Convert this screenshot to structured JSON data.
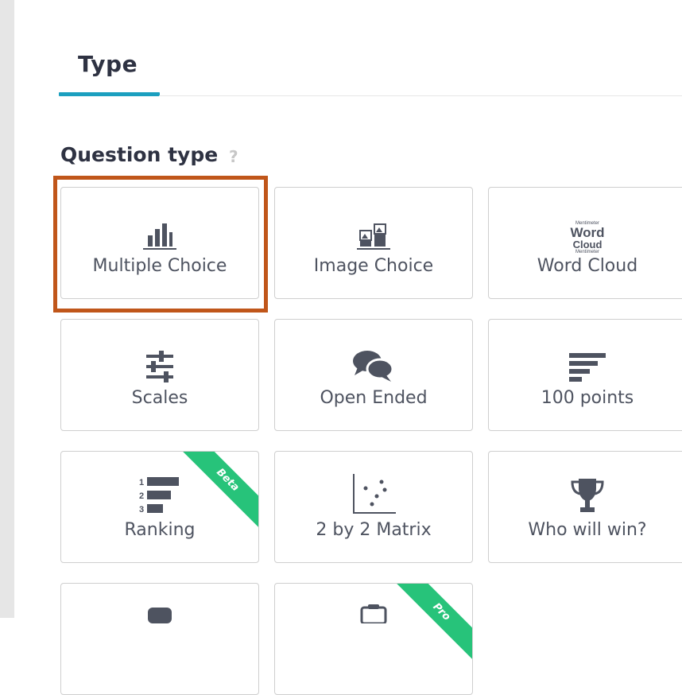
{
  "tab": {
    "label": "Type"
  },
  "section": {
    "heading": "Question type",
    "help": "?"
  },
  "cards": [
    {
      "label": "Multiple Choice",
      "icon": "bar-chart-icon"
    },
    {
      "label": "Image Choice",
      "icon": "image-choice-icon"
    },
    {
      "label": "Word Cloud",
      "icon": "word-cloud-icon"
    },
    {
      "label": "Scales",
      "icon": "sliders-icon"
    },
    {
      "label": "Open Ended",
      "icon": "speech-bubbles-icon"
    },
    {
      "label": "100 points",
      "icon": "horizontal-bars-icon"
    },
    {
      "label": "Ranking",
      "icon": "ranking-icon",
      "ribbon": "Beta"
    },
    {
      "label": "2 by 2 Matrix",
      "icon": "scatter-plot-icon"
    },
    {
      "label": "Who will win?",
      "icon": "trophy-icon"
    },
    {
      "label": "",
      "icon": "partial-card-icon"
    },
    {
      "label": "",
      "icon": "clipboard-icon",
      "ribbon": "Pro"
    }
  ],
  "word_cloud_icon_text": {
    "line1": "Word",
    "line2": "Cloud",
    "tiny1": "Mentimeter",
    "tiny2": "Mentimeter"
  },
  "ranking_icon_numbers": [
    "1",
    "2",
    "3"
  ],
  "colors": {
    "accent": "#1b9fbf",
    "highlight": "#c0561a",
    "ribbon": "#27c37a",
    "icon": "#4e5360"
  }
}
